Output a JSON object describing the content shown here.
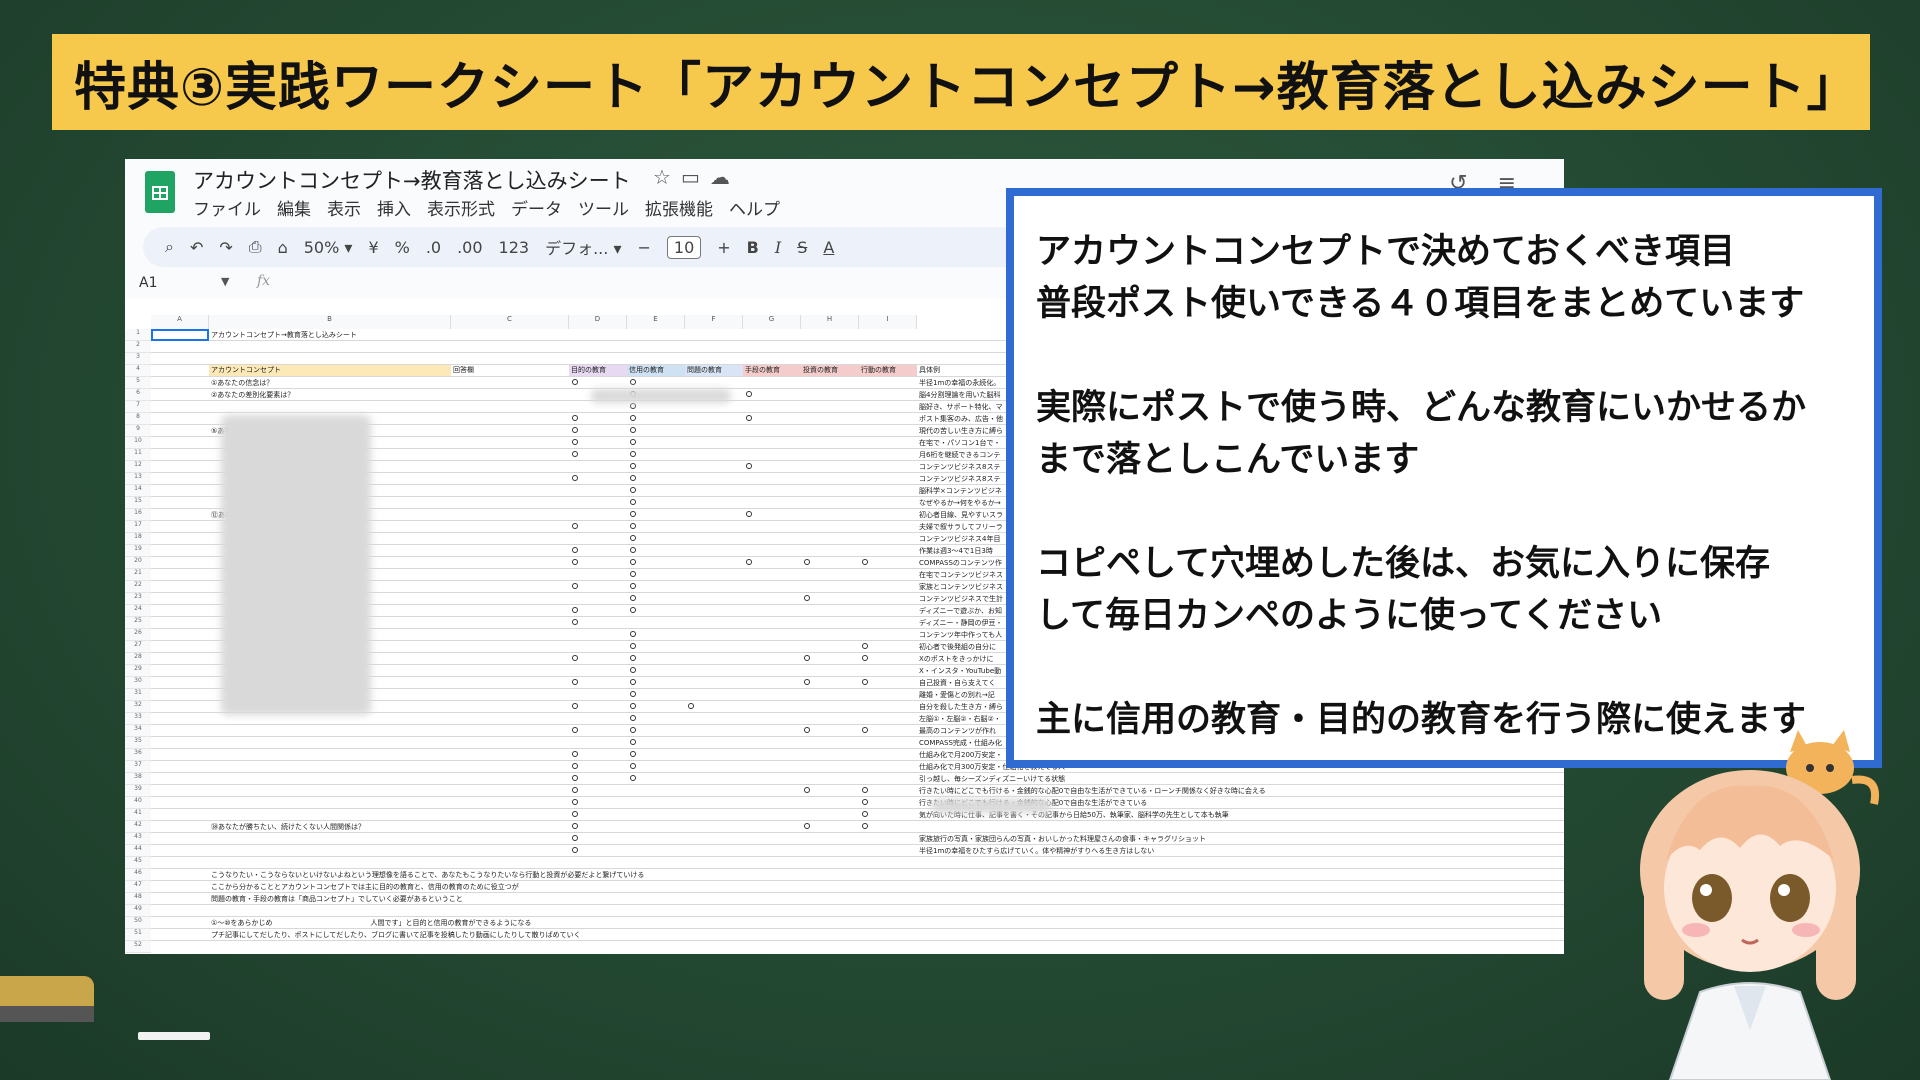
{
  "banner": {
    "title": "特典③実践ワークシート「アカウントコンセプト→教育落とし込みシート」"
  },
  "sheet": {
    "doc_title": "アカウントコンセプト→教育落とし込みシート",
    "menu": [
      "ファイル",
      "編集",
      "表示",
      "挿入",
      "表示形式",
      "データ",
      "ツール",
      "拡張機能",
      "ヘルプ"
    ],
    "toolbar": {
      "zoom": "50%",
      "currency": "¥",
      "percent": "%",
      "dec_decrease": ".0",
      "dec_increase": ".00",
      "number_format": "123",
      "font": "デフォ...",
      "minus": "−",
      "font_size": "10",
      "plus": "+",
      "bold": "B",
      "italic": "I",
      "strike": "S",
      "text_color": "A"
    },
    "cell_ref": "A1",
    "fx": "fx",
    "columns": [
      "A",
      "B",
      "C",
      "D",
      "E",
      "F",
      "G",
      "H",
      "I"
    ],
    "a1_text": "アカウントコンセプト→教育落とし込みシート",
    "table_headers": [
      "アカウントコンセプト",
      "回答欄",
      "目的の教育",
      "信用の教育",
      "問題の教育",
      "手段の教育",
      "投資の教育",
      "行動の教育",
      "具体例"
    ],
    "rows": [
      {
        "q": "①あなたの信念は？",
        "ex": "半径1mの幸福の永続化。"
      },
      {
        "q": "②あなたの差別化要素は？",
        "ex": "脳4分割理論を用いた脳科"
      },
      {
        "q": "",
        "ex": "脳好き、サポート特化、マ"
      },
      {
        "q": "",
        "ex": "ポスト集客のみ、広告・他"
      },
      {
        "q": "⑤あなたのターゲットは？",
        "ex": "現代の苦しい生き方に縛ら"
      },
      {
        "q": "",
        "ex": "在宅で・パソコン1台で・"
      },
      {
        "q": "",
        "ex": "月6桁を継続できるコンテ"
      },
      {
        "q": "",
        "ex": "コンテンツビジネス8ステ"
      },
      {
        "q": "",
        "ex": "コンテンツビジネス8ステ"
      },
      {
        "q": "",
        "ex": "脳科学×コンテンツビジネ"
      },
      {
        "q": "",
        "ex": "なぜやるか→何をやるか→"
      },
      {
        "q": "⑫あなたのライバルと並んだ時の強みは？",
        "ex": "初心者目線、見やすいスラ"
      },
      {
        "q": "",
        "ex": "夫婦で叙サラしてフリーラ"
      },
      {
        "q": "",
        "ex": "コンテンツビジネス4年目"
      },
      {
        "q": "",
        "ex": "作業は週3〜4で1日3時"
      },
      {
        "q": "",
        "ex": "COMPASSのコンテンツ作"
      },
      {
        "q": "",
        "ex": "在宅でコンテンツビジネス"
      },
      {
        "q": "",
        "ex": "家族とコンテンツビジネス"
      },
      {
        "q": "",
        "ex": "コンテンツビジネスで生計"
      },
      {
        "q": "",
        "ex": "ディズニーで遊ぶか、お知"
      },
      {
        "q": "",
        "ex": "ディズニー・静岡の伊豆・"
      },
      {
        "q": "",
        "ex": "コンテンツ年中作っても人"
      },
      {
        "q": "",
        "ex": "初心者で後発組の自分に"
      },
      {
        "q": "",
        "ex": "Xのポストをきっかけに"
      },
      {
        "q": "",
        "ex": "X・インスタ・YouTube動"
      },
      {
        "q": "",
        "ex": "自己投資・自ら支えてく"
      },
      {
        "q": "",
        "ex": "離婚・愛傷との別れ→記"
      },
      {
        "q": "",
        "ex": "自分を殺した生き方・縛ら"
      },
      {
        "q": "",
        "ex": "左脳①・左脳②・右脳②・"
      },
      {
        "q": "",
        "ex": "最高のコンテンツが作れ"
      },
      {
        "q": "",
        "ex": "COMPASS完成・仕組み化"
      },
      {
        "q": "",
        "ex": "仕組み化で月200万安定・"
      },
      {
        "q": "",
        "ex": "仕組み化で月300万安定・仕組化を教えてる人"
      },
      {
        "q": "",
        "ex": "引っ越し、毎シーズンディズニーいけてる状態"
      },
      {
        "q": "",
        "ex": "行きたい時にどこでも行ける・金銭的な心配0で自由な生活ができている・ローンチ関係なく好きな時に会える"
      },
      {
        "q": "",
        "ex": "行きたい時にどこでも行ける・金銭的な心配0で自由な生活ができている"
      },
      {
        "q": "",
        "ex": "気が向いた時に仕事、記事を書く・その記事から日給50万、執筆家、脳科学の先生として本も執筆"
      },
      {
        "q": "㊳あなたが勝ちたい、続けたくない人間関係は？",
        "ex": ""
      },
      {
        "q": "",
        "ex": "家族旅行の写真・家族団らんの写真・おいしかった料理屋さんの食事・キャラグリショット"
      },
      {
        "q": "",
        "ex": "半径1mの幸福をひたすら広げていく。体や精神がすりへる生き方はしない"
      }
    ],
    "notes": [
      "こうなりたい・こうならないといけないよねという理想像を語ることで、あなたもこうなりたいなら行動と投資が必要だよと繋げていける",
      "ここから分かることとアカウントコンセプトでは主に目的の教育と、信用の教育のために役立つが",
      "問題の教育・手段の教育は「商品コンセプト」でしていく必要があるということ",
      "①〜⑩をあらかじめ　　　　　　　　　　　　　　人間です」と目的と信用の教育ができるようになる",
      "プチ記事にしてだしたり、ポストにしてだしたり、ブログに書いて記事を投稿したり動画にしたりして散りばめていく"
    ]
  },
  "callout": {
    "lines": [
      "アカウントコンセプトで決めておくべき項目",
      "普段ポスト使いできる４０項目をまとめています",
      "",
      "実際にポストで使う時、どんな教育にいかせるか",
      "まで落としこんでいます",
      "",
      "コピペして穴埋めした後は、お気に入りに保存",
      "して毎日カンペのように使ってください",
      "",
      "主に信用の教育・目的の教育を行う際に使えます"
    ]
  },
  "colors": {
    "board": "#244a33",
    "banner": "#f6c84c",
    "callout_border": "#2f6bd0",
    "sheets_green": "#1fa463"
  }
}
